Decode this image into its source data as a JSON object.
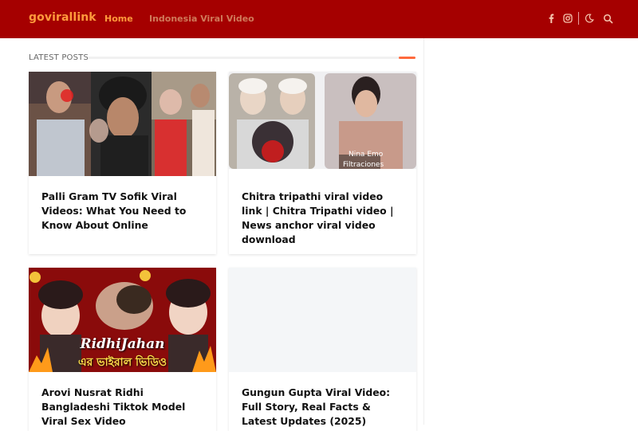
{
  "header": {
    "brand": "govirallink",
    "nav": [
      {
        "label": "Home"
      },
      {
        "label": "Indonesia Viral Video"
      }
    ],
    "icons": [
      "facebook-icon",
      "instagram-icon",
      "dark-mode-moon-icon",
      "search-icon"
    ]
  },
  "section": {
    "title": "LATEST POSTS"
  },
  "posts": [
    {
      "title": "Palli Gram TV Sofik Viral Videos: What You Need to Know About Online"
    },
    {
      "title": "Chitra tripathi viral video link | Chitra Tripathi video | News anchor viral video download",
      "thumb_caption": "Nina Emo Filtraciones"
    },
    {
      "title": "Arovi Nusrat Ridhi Bangladeshi Tiktok Model Viral Sex Video",
      "thumb_caption_1": "RidhiJahan",
      "thumb_caption_2": "এর ভাইরাল ভিডিও"
    },
    {
      "title": "Gungun Gupta Viral Video: Full Story, Real Facts & Latest Updates (2025)"
    }
  ],
  "colors": {
    "header_bg": "#a50000",
    "brand": "#ff9a3c",
    "accent": "#ff6a3d"
  }
}
